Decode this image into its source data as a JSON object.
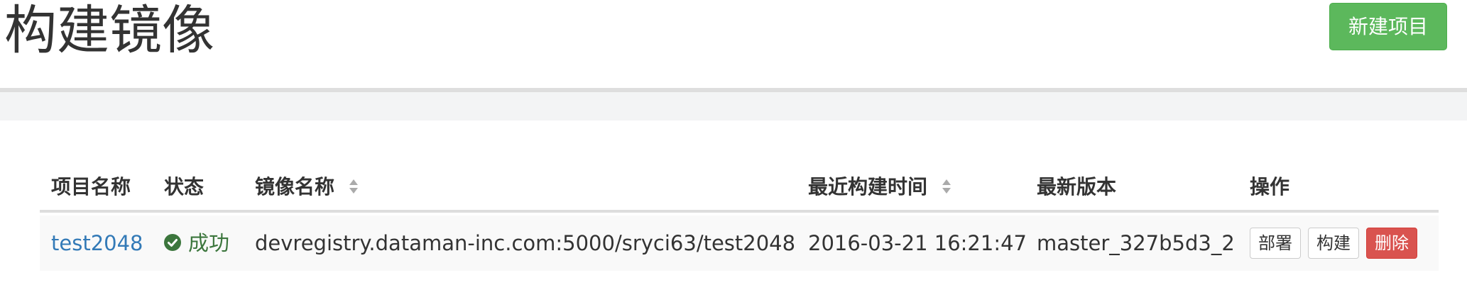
{
  "header": {
    "title": "构建镜像",
    "new_project_label": "新建项目"
  },
  "table": {
    "columns": [
      "项目名称",
      "状态",
      "镜像名称",
      "最近构建时间",
      "最新版本",
      "操作"
    ],
    "rows": [
      {
        "project": "test2048",
        "status": "成功",
        "image": "devregistry.dataman-inc.com:5000/sryci63/test2048",
        "last_build": "2016-03-21 16:21:47",
        "version": "master_327b5d3_2",
        "actions": {
          "deploy": "部署",
          "build": "构建",
          "delete": "删除"
        }
      }
    ]
  },
  "colors": {
    "primary_link": "#337ab7",
    "success": "#5cb85c",
    "success_text": "#3c763d",
    "danger": "#d9534f"
  },
  "icons": {
    "status": "check-circle-icon",
    "sort": "sort-icon"
  }
}
